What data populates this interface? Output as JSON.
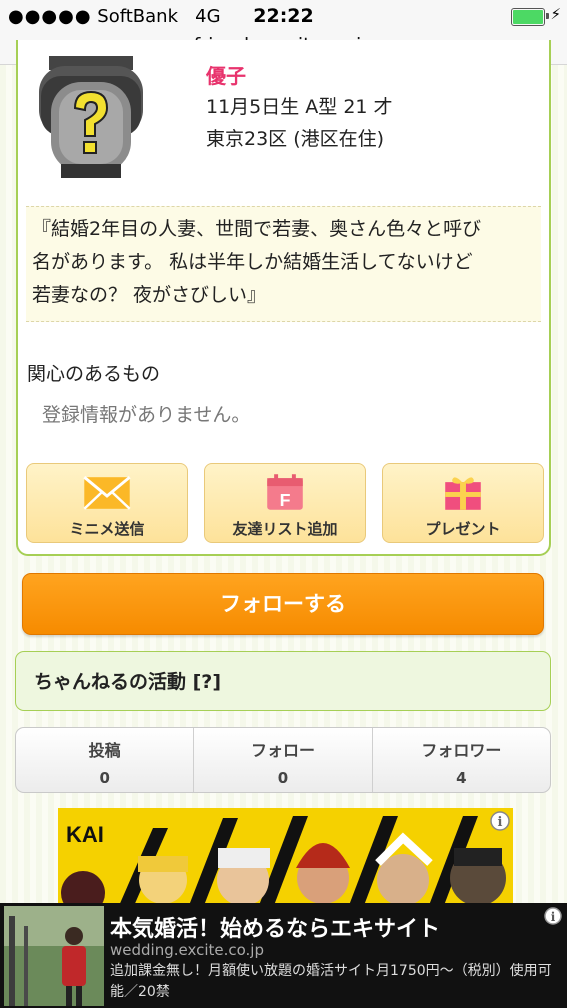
{
  "status_bar": {
    "carrier": "SoftBank",
    "network": "4G",
    "time": "22:22",
    "url": "friends.excite.co.jp"
  },
  "profile": {
    "name": "優子",
    "birth_blood_age": "11月5日生 A型 21 才",
    "location": "東京23区 (港区在住)",
    "quote_lines": [
      "『結婚2年目の人妻、世間で若妻、奥さん色々と呼び",
      "名があります。 私は半年しか結婚生活してないけど",
      "若妻なの？ 夜がさびしい』"
    ],
    "interests_label": "関心のあるもの",
    "interests_empty": "登録情報がありません。"
  },
  "actions": {
    "mail": "ミニメ送信",
    "friend": "友達リスト追加",
    "present": "プレゼント"
  },
  "follow_label": "フォローする",
  "channel": {
    "title": "ちゃんねるの活動 [?]",
    "stats": [
      {
        "label": "投稿",
        "value": "0"
      },
      {
        "label": "フォロー",
        "value": "0"
      },
      {
        "label": "フォロワー",
        "value": "4"
      }
    ]
  },
  "ad_banner": {
    "brand": "KAI"
  },
  "bottom_ad": {
    "title": "本気婚活！始めるならエキサイト",
    "domain": "wedding.excite.co.jp",
    "description": "追加課金無し！月額使い放題の婚活サイト月1750円〜（税別）使用可能／20禁"
  },
  "colors": {
    "name_pink": "#e8336d",
    "follow_orange": "#f68b00",
    "card_green": "#a6cf55",
    "battery_green": "#4cd964"
  }
}
